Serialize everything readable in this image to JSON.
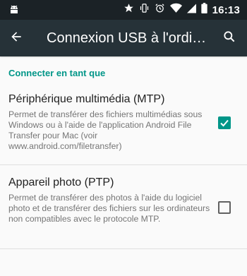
{
  "status_bar": {
    "time": "16:13",
    "icons": [
      "android-icon",
      "star-icon",
      "vibrate-icon",
      "alarm-icon",
      "wifi-icon",
      "battery-icon"
    ]
  },
  "app_bar": {
    "title": "Connexion USB à l'ordinateur",
    "back_icon": "arrow-back-icon",
    "search_icon": "search-icon"
  },
  "section": {
    "header": "Connecter en tant que"
  },
  "options": [
    {
      "title": "Périphérique multimédia (MTP)",
      "description": "Permet de transférer des fichiers multimédias sous Windows ou à l'aide de l'application Android File Transfer pour Mac (voir www.android.com/filetransfer)",
      "checked": true
    },
    {
      "title": "Appareil photo (PTP)",
      "description": "Permet de transférer des photos à l'aide du logiciel photo et de transférer des fichiers sur les ordinateurs non compatibles avec le protocole MTP.",
      "checked": false
    }
  ],
  "colors": {
    "status_bar": "#1b2226",
    "app_bar": "#263238",
    "accent": "#009688",
    "background": "#fafafa"
  }
}
